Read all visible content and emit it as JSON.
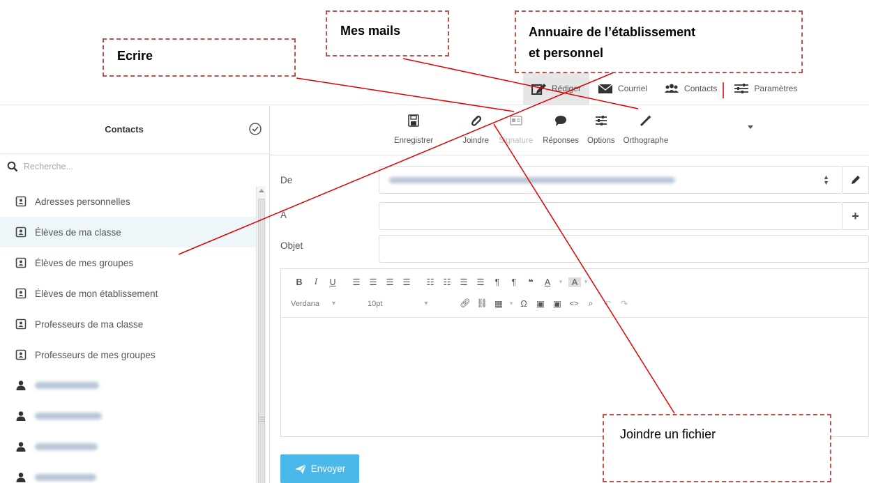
{
  "nav": {
    "items": [
      {
        "label": "Rédiger",
        "icon": "pencil-square-icon",
        "active": true
      },
      {
        "label": "Courriel",
        "icon": "envelope-icon",
        "active": false
      },
      {
        "label": "Contacts",
        "icon": "users-icon",
        "active": false
      },
      {
        "label": "Paramètres",
        "icon": "sliders-icon",
        "active": false
      }
    ]
  },
  "contacts": {
    "title": "Contacts",
    "search_placeholder": "Recherche...",
    "items": [
      {
        "label": "Adresses personnelles",
        "icon": "address-book-icon"
      },
      {
        "label": "Élèves de ma classe",
        "icon": "address-book-icon",
        "selected": true
      },
      {
        "label": "Élèves de mes groupes",
        "icon": "address-book-icon"
      },
      {
        "label": "Élèves de mon établissement",
        "icon": "address-book-icon"
      },
      {
        "label": "Professeurs de ma classe",
        "icon": "address-book-icon"
      },
      {
        "label": "Professeurs de mes groupes",
        "icon": "address-book-icon"
      }
    ]
  },
  "compose_toolbar": {
    "save": "Enregistrer",
    "attach": "Joindre",
    "signature": "Signature",
    "responses": "Réponses",
    "options": "Options",
    "spelling": "Orthographe"
  },
  "form": {
    "from_label": "De",
    "to_label": "À",
    "subject_label": "Objet"
  },
  "editor": {
    "font_family": "Verdana",
    "font_size": "10pt"
  },
  "send_label": "Envoyer",
  "annotations": {
    "write": "Ecrire",
    "my_mails": "Mes mails",
    "directory_line1": "Annuaire de l’établissement",
    "directory_line2": "et personnel",
    "attach_file": "Joindre un fichier"
  },
  "colors": {
    "accent": "#4ab8e8",
    "annotation": "#c0504d",
    "line": "#e00000"
  }
}
